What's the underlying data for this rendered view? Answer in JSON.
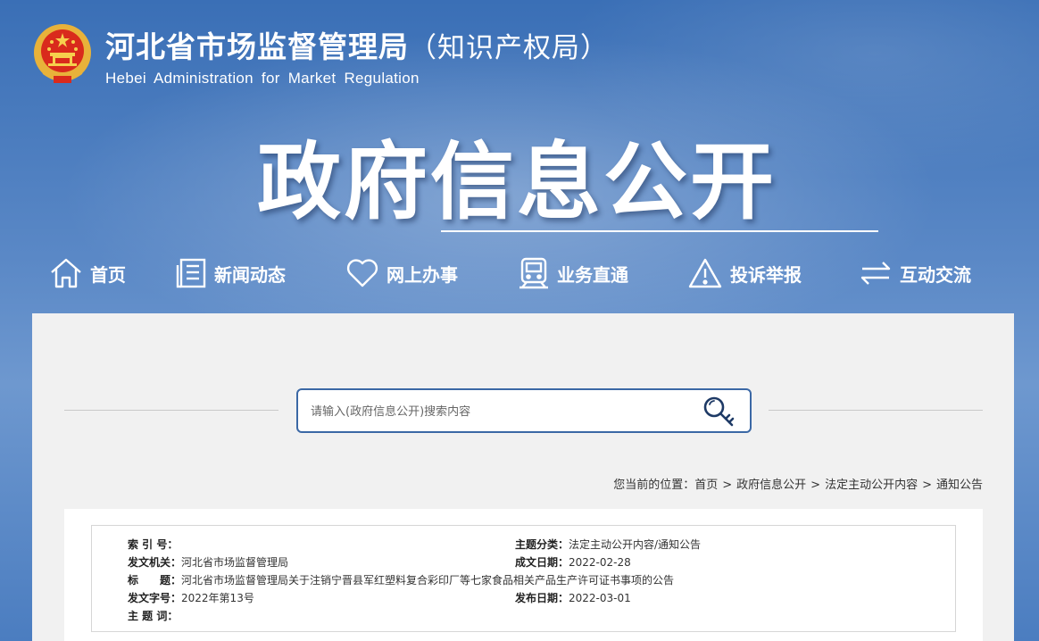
{
  "header": {
    "title": "河北省市场监督管理局",
    "title_sub": "（知识产权局）",
    "subtitle_en": "Hebei Administration for Market Regulation"
  },
  "banner": {
    "title": "政府信息公开"
  },
  "nav": {
    "items": [
      {
        "label": "首页",
        "icon": "home-icon"
      },
      {
        "label": "新闻动态",
        "icon": "news-icon"
      },
      {
        "label": "网上办事",
        "icon": "heart-icon"
      },
      {
        "label": "业务直通",
        "icon": "train-icon"
      },
      {
        "label": "投诉举报",
        "icon": "warning-icon"
      },
      {
        "label": "互动交流",
        "icon": "exchange-icon"
      }
    ]
  },
  "search": {
    "placeholder": "请输入(政府信息公开)搜索内容",
    "icon": "search-key-icon"
  },
  "breadcrumb": {
    "prefix": "您当前的位置：",
    "items": [
      "首页",
      "政府信息公开",
      "法定主动公开内容",
      "通知公告"
    ],
    "separator": ">"
  },
  "info": {
    "index_no_label": "索 引 号：",
    "index_no": "",
    "topic_label": "主题分类：",
    "topic": "法定主动公开内容/通知公告",
    "issuer_label": "发文机关：",
    "issuer": "河北省市场监督管理局",
    "date_label": "成文日期：",
    "date": "2022-02-28",
    "title_label": "标　　题：",
    "title": "河北省市场监督管理局关于注销宁晋县军红塑料复合彩印厂等七家食品相关产品生产许可证书事项的公告",
    "doc_no_label": "发文字号：",
    "doc_no": "2022年第13号",
    "publish_label": "发布日期：",
    "publish": "2022-03-01",
    "keywords_label": "主 题 词：",
    "keywords": ""
  },
  "colors": {
    "brand_blue": "#3b68a5",
    "banner_bg": "#4b7dc0",
    "panel_bg": "#f1f1f1"
  }
}
